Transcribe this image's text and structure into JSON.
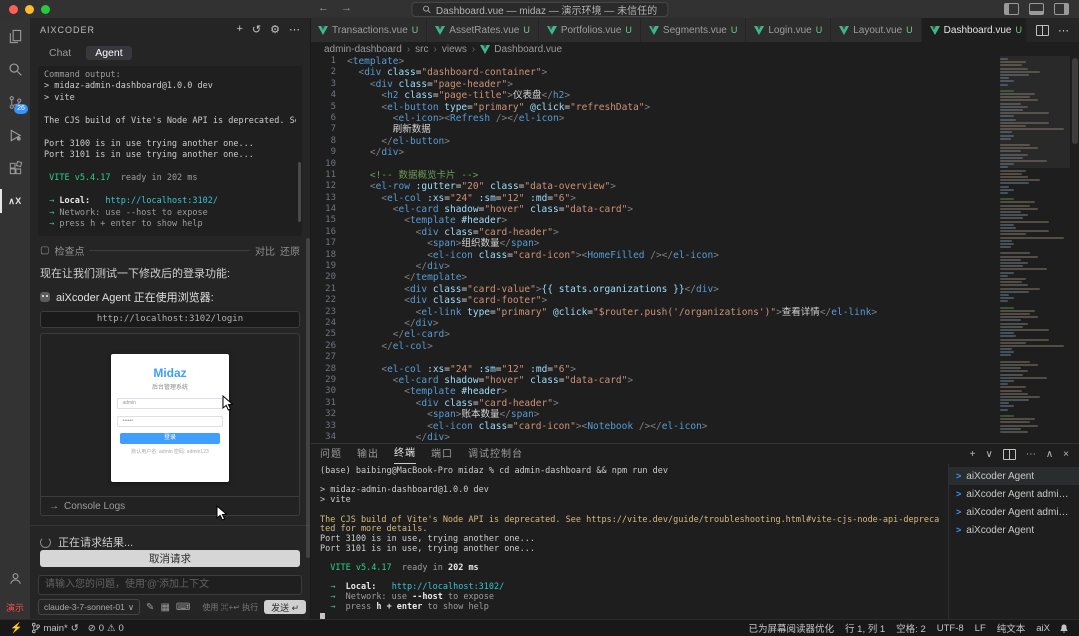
{
  "icons": {
    "back": "←",
    "forward": "→",
    "add": "+",
    "history": "↺",
    "settings": "⚙",
    "more": "⋯",
    "chevron_down": "∨",
    "chevron_up": "∧",
    "close": "×",
    "arrow_right": "→",
    "checkpoint": "▢",
    "pen": "✎",
    "image": "▦",
    "keyboard": "⌨",
    "dropdown": "∨",
    "enter": "↵",
    "remote": "⚡",
    "sync": "↺",
    "error": "⊘",
    "warning": "⚠"
  },
  "title_bar": {
    "title": "Dashboard.vue — midaz — 演示环境 — 未信任的"
  },
  "activity_bar": {
    "scm_badge": "26",
    "aix_label": "∧X",
    "profile_badge": "演示"
  },
  "sidebar": {
    "header": "AIXCODER",
    "tabs": [
      {
        "label": "Chat"
      },
      {
        "label": "Agent"
      }
    ],
    "output_lines": [
      [
        [
          "Command output:",
          "d"
        ]
      ],
      [
        [
          "> midaz-admin-dashboard@1.0.0 dev",
          "p"
        ]
      ],
      [
        [
          "> vite",
          "p"
        ]
      ],
      [],
      [
        [
          "The CJS build of Vite's Node API is deprecated. See https://vit",
          "p"
        ]
      ],
      [],
      [
        [
          "Port 3100 is in use trying another one...",
          "p"
        ]
      ],
      [
        [
          "Port 3101 is in use trying another one...",
          "p"
        ]
      ],
      [],
      [
        [
          " VITE v5.4.17",
          "g"
        ],
        [
          "  ready in 202 ms",
          "d"
        ]
      ],
      [],
      [
        [
          " → ",
          "g"
        ],
        [
          "Local:   ",
          "w"
        ],
        [
          "http://localhost:3102/",
          "cy"
        ]
      ],
      [
        [
          " → ",
          "g"
        ],
        [
          "Network: use --host to expose",
          "d"
        ]
      ],
      [
        [
          " → ",
          "g"
        ],
        [
          "press h + enter to show help",
          "d"
        ]
      ]
    ],
    "checkpoint": {
      "label": "检查点",
      "compare": "对比",
      "restore": "还原"
    },
    "message": "现在让我们测试一下修改后的登录功能:",
    "agent_status": "aiXcoder Agent 正在使用浏览器:",
    "browser": {
      "url": "http://localhost:3102/login",
      "page": {
        "brand": "Midaz",
        "subtitle": "后台管理系统",
        "username": "admin",
        "password": "••••••",
        "login_button": "登录",
        "hint": "默认用户名: admin 密码: admin123"
      },
      "console_logs": "Console Logs"
    },
    "pending": "正在请求结果...",
    "cancel_button": "取消请求",
    "composer": {
      "placeholder": "请输入您的问题，使用'@'添加上下文",
      "model": "claude-3-7-sonnet-01",
      "shortcut_hint": "使用 ⌘+↵ 执行",
      "send_label": "发送 ↵"
    }
  },
  "editor": {
    "tabs": [
      {
        "name": "Transactions.vue",
        "badge": "U"
      },
      {
        "name": "AssetRates.vue",
        "badge": "U"
      },
      {
        "name": "Portfolios.vue",
        "badge": "U"
      },
      {
        "name": "Segments.vue",
        "badge": "U"
      },
      {
        "name": "Login.vue",
        "badge": "U"
      },
      {
        "name": "Layout.vue",
        "badge": "U"
      },
      {
        "name": "Dashboard.vue",
        "badge": "U",
        "active": true
      }
    ],
    "breadcrumb": [
      "admin-dashboard",
      "src",
      "views",
      "Dashboard.vue"
    ],
    "code_lines": [
      "<template>",
      "  <div class=\"dashboard-container\">",
      "    <div class=\"page-header\">",
      "      <h2 class=\"page-title\">仪表盘</h2>",
      "      <el-button type=\"primary\" @click=\"refreshData\">",
      "        <el-icon><Refresh /></el-icon>",
      "        刷新数据",
      "      </el-button>",
      "    </div>",
      "",
      "    <!-- 数据概览卡片 -->",
      "    <el-row :gutter=\"20\" class=\"data-overview\">",
      "      <el-col :xs=\"24\" :sm=\"12\" :md=\"6\">",
      "        <el-card shadow=\"hover\" class=\"data-card\">",
      "          <template #header>",
      "            <div class=\"card-header\">",
      "              <span>组织数量</span>",
      "              <el-icon class=\"card-icon\"><HomeFilled /></el-icon>",
      "            </div>",
      "          </template>",
      "          <div class=\"card-value\">{{ stats.organizations }}</div>",
      "          <div class=\"card-footer\">",
      "            <el-link type=\"primary\" @click=\"$router.push('/organizations')\">查看详情</el-link>",
      "          </div>",
      "        </el-card>",
      "      </el-col>",
      "",
      "      <el-col :xs=\"24\" :sm=\"12\" :md=\"6\">",
      "        <el-card shadow=\"hover\" class=\"data-card\">",
      "          <template #header>",
      "            <div class=\"card-header\">",
      "              <span>账本数量</span>",
      "              <el-icon class=\"card-icon\"><Notebook /></el-icon>",
      "            </div>"
    ]
  },
  "panel": {
    "tabs": [
      "问题",
      "输出",
      "终端",
      "端口",
      "调试控制台"
    ],
    "active_tab": "终端",
    "terminal_lines": [
      [
        [
          "(base) baibing@MacBook-Pro midaz % ",
          "p"
        ],
        [
          "cd admin-dashboard && npm run dev",
          "p"
        ]
      ],
      [],
      [
        [
          "> midaz-admin-dashboard@1.0.0 dev",
          "p"
        ]
      ],
      [
        [
          "> vite",
          "p"
        ]
      ],
      [],
      [
        [
          "The CJS build of Vite's Node API is deprecated. See https://vite.dev/guide/troubleshooting.html#vite-cjs-node-api-deprecated for more details.",
          "y"
        ]
      ],
      [
        [
          "Port 3100 is in use, trying another one...",
          "p"
        ]
      ],
      [
        [
          "Port 3101 is in use, trying another one...",
          "p"
        ]
      ],
      [],
      [
        [
          "  VITE v5.4.17",
          "g"
        ],
        [
          "  ready in ",
          "d"
        ],
        [
          "202 ms",
          "w"
        ]
      ],
      [],
      [
        [
          "  →  ",
          "g"
        ],
        [
          "Local:",
          "w"
        ],
        [
          "   ",
          "p"
        ],
        [
          "http://localhost:3102/",
          "cy"
        ]
      ],
      [
        [
          "  →  ",
          "g"
        ],
        [
          "Network: use ",
          "d"
        ],
        [
          "--host",
          "w"
        ],
        [
          " to expose",
          "d"
        ]
      ],
      [
        [
          "  →  ",
          "g"
        ],
        [
          "press ",
          "d"
        ],
        [
          "h + enter",
          "w"
        ],
        [
          " to show help",
          "d"
        ]
      ],
      [
        [
          "",
          "cur"
        ]
      ]
    ],
    "terminal_list": [
      "aiXcoder Agent",
      "aiXcoder Agent admin-da...",
      "aiXcoder Agent admin-da...",
      "aiXcoder Agent"
    ]
  },
  "status_bar": {
    "branch": "main*",
    "errors": "0",
    "warnings": "0",
    "right_items": [
      "已为屏幕阅读器优化",
      "行 1, 列 1",
      "空格: 2",
      "UTF-8",
      "LF",
      "纯文本",
      "aiX"
    ]
  },
  "colors": {
    "accent_blue": "#3794ff",
    "vue_green": "#41b883",
    "brand_blue": "#409eff"
  }
}
